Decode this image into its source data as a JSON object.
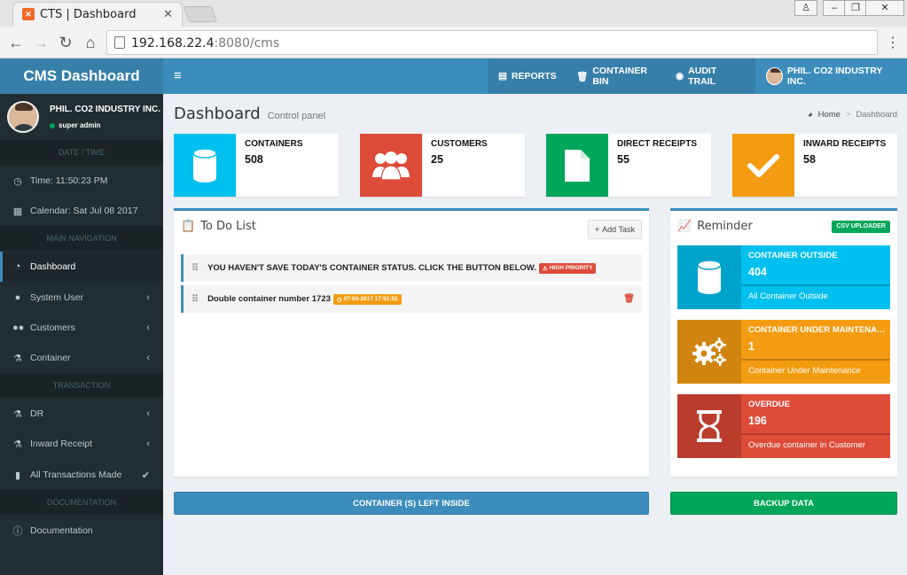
{
  "browser": {
    "tab_title": "CTS | Dashboard",
    "favicon": "xampp-icon",
    "url_host": "192.168.22.4",
    "url_rest": ":8080/cms"
  },
  "app": {
    "logo": "CMS Dashboard",
    "topnav": {
      "reports": "REPORTS",
      "container_bin": "CONTAINER BIN",
      "audit_trail": "AUDIT TRAIL",
      "company": "PHIL. CO2 INDUSTRY INC."
    }
  },
  "sidebar": {
    "user_name": "PHIL. CO2 INDUSTRY INC.",
    "user_role": "super admin",
    "headers": {
      "datetime": "DATE / TIME",
      "main_navigation": "MAIN NAVIGATION",
      "transaction": "TRANSACTION",
      "documentation": "DOCUMENTATION"
    },
    "time": "Time: 11:50:23 PM",
    "calendar": "Calendar: Sat Jul 08 2017",
    "items": {
      "dashboard": "Dashboard",
      "system_user": "System User",
      "customers": "Customers",
      "container": "Container",
      "dr": "DR",
      "inward_receipt": "Inward Receipt",
      "all_transactions": "All Transactions Made",
      "documentation": "Documentation"
    }
  },
  "content": {
    "title": "Dashboard",
    "subtitle": "Control panel",
    "breadcrumb_home": "Home",
    "breadcrumb_current": "Dashboard"
  },
  "info_boxes": [
    {
      "label": "CONTAINERS",
      "value": "508",
      "color": "#00c0ef",
      "icon": "database-icon"
    },
    {
      "label": "CUSTOMERS",
      "value": "25",
      "color": "#dd4b39",
      "icon": "users-icon"
    },
    {
      "label": "DIRECT RECEIPTS",
      "value": "55",
      "color": "#00a65a",
      "icon": "file-icon"
    },
    {
      "label": "INWARD RECEIPTS",
      "value": "58",
      "color": "#f39c12",
      "icon": "check-icon"
    }
  ],
  "todo": {
    "title": "To Do List",
    "add_task": "Add Task",
    "items": [
      {
        "text": "YOU HAVEN'T SAVE TODAY'S CONTAINER STATUS. CLICK THE BUTTON BELOW.",
        "badge": "HIGH PRIORITY"
      },
      {
        "text": "Double container number 1723",
        "badge": "07-03-2017 17:51:52"
      }
    ]
  },
  "reminder": {
    "title": "Reminder",
    "csv_uploader": "CSV UPLOADER",
    "boxes": [
      {
        "title": "CONTAINER OUTSIDE",
        "value": "404",
        "desc": "All Container Outside",
        "color": "#00c0ef",
        "icon": "database-icon"
      },
      {
        "title": "CONTAINER UNDER MAINTENANCE",
        "value": "1",
        "desc": "Container Under Maintenance",
        "color": "#f39c12",
        "icon": "gears-icon"
      },
      {
        "title": "OVERDUE",
        "value": "196",
        "desc": "Overdue container in Customer",
        "color": "#dd4b39",
        "icon": "hourglass-icon"
      }
    ]
  },
  "buttons": {
    "left_inside": "CONTAINER (S) LEFT INSIDE",
    "backup": "BACKUP DATA"
  }
}
